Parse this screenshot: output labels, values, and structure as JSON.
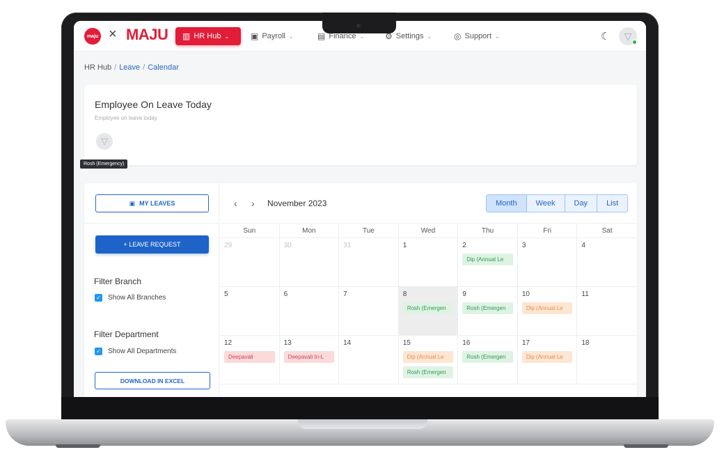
{
  "nav": {
    "logo_badge": "maju",
    "logo_x": "×",
    "logo_word": "MAJU",
    "items": [
      {
        "label": "HR Hub",
        "icon": "building-icon"
      },
      {
        "label": "Payroll",
        "icon": "cash-icon"
      },
      {
        "label": "Finance",
        "icon": "document-icon"
      },
      {
        "label": "Settings",
        "icon": "gear-icon"
      },
      {
        "label": "Support",
        "icon": "lifebuoy-icon"
      }
    ],
    "chevron": "⌄",
    "active_color": "#e21d38"
  },
  "breadcrumb": {
    "root": "HR Hub",
    "sep": "/",
    "level1": "Leave",
    "level2": "Calendar"
  },
  "leave_today": {
    "title": "Employee On Leave Today",
    "subtitle": "Employee on leave today",
    "tooltip": "Rosh (Emergency)"
  },
  "sidebar": {
    "my_leaves": "MY LEAVES",
    "leave_request": "+ LEAVE REQUEST",
    "filter_branch_title": "Filter Branch",
    "show_all_branches": "Show All Branches",
    "filter_department_title": "Filter Department",
    "show_all_departments": "Show All Departments",
    "download_excel": "DOWNLOAD IN EXCEL"
  },
  "calendar": {
    "title": "November 2023",
    "prev": "‹",
    "next": "›",
    "views": [
      "Month",
      "Week",
      "Day",
      "List"
    ],
    "active_view": "Month",
    "days_of_week": [
      "Sun",
      "Mon",
      "Tue",
      "Wed",
      "Thu",
      "Fri",
      "Sat"
    ],
    "weeks": [
      [
        {
          "day": "29",
          "muted": true,
          "events": []
        },
        {
          "day": "30",
          "muted": true,
          "events": []
        },
        {
          "day": "31",
          "muted": true,
          "events": []
        },
        {
          "day": "1",
          "events": []
        },
        {
          "day": "2",
          "events": [
            {
              "label": "Dip (Annual Le",
              "color": "green"
            }
          ]
        },
        {
          "day": "3",
          "events": []
        },
        {
          "day": "4",
          "events": []
        }
      ],
      [
        {
          "day": "5",
          "events": []
        },
        {
          "day": "6",
          "events": []
        },
        {
          "day": "7",
          "events": []
        },
        {
          "day": "8",
          "today": true,
          "events": [
            {
              "label": "Rosh (Emergen",
              "color": "green"
            }
          ]
        },
        {
          "day": "9",
          "events": [
            {
              "label": "Rosh (Emergen",
              "color": "green"
            }
          ]
        },
        {
          "day": "10",
          "events": [
            {
              "label": "Dip (Annual Le",
              "color": "orange"
            }
          ]
        },
        {
          "day": "11",
          "events": []
        }
      ],
      [
        {
          "day": "12",
          "events": [
            {
              "label": "Deepavali",
              "color": "red"
            }
          ]
        },
        {
          "day": "13",
          "events": [
            {
              "label": "Deepavali In-L",
              "color": "red"
            }
          ]
        },
        {
          "day": "14",
          "events": []
        },
        {
          "day": "15",
          "events": [
            {
              "label": "Dip (Annual Le",
              "color": "orange"
            },
            {
              "label": "Rosh (Emergen",
              "color": "green"
            }
          ]
        },
        {
          "day": "16",
          "events": [
            {
              "label": "Rosh (Emergen",
              "color": "green"
            }
          ]
        },
        {
          "day": "17",
          "events": [
            {
              "label": "Dip (Annual Le",
              "color": "orange"
            }
          ]
        },
        {
          "day": "18",
          "events": []
        }
      ]
    ]
  },
  "colors": {
    "primary_blue": "#1e63c8",
    "event_green": "#2f9a4e",
    "event_orange": "#f08a3c",
    "event_red": "#d8404f"
  }
}
